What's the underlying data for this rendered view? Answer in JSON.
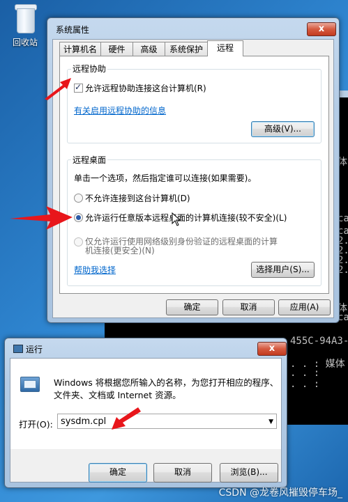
{
  "desktop": {
    "recycle_bin_label": "回收站"
  },
  "console": {
    "lines": [
      "体",
      "ca",
      "ca",
      "2.",
      "2.",
      "2.",
      "2.",
      "体",
      "ca",
      "455C-94A3-",
      ". . : 媒体",
      ". . :",
      ". . :"
    ]
  },
  "system_properties": {
    "title": "系统属性",
    "close_label": "x",
    "tabs": [
      "计算机名",
      "硬件",
      "高级",
      "系统保护",
      "远程"
    ],
    "active_tab": "远程",
    "remote_assistance": {
      "group_title": "远程协助",
      "checkbox_label": "允许远程协助连接这台计算机(R)",
      "checked": true,
      "info_link": "有关启用远程协助的信息",
      "advanced_button": "高级(V)..."
    },
    "remote_desktop": {
      "group_title": "远程桌面",
      "instruction": "单击一个选项，然后指定谁可以连接(如果需要)。",
      "option1": "不允许连接到这台计算机(D)",
      "option2": "允许运行任意版本远程桌面的计算机连接(较不安全)(L)",
      "option3_line1": "仅允许运行使用网络级别身份验证的远程桌面的计算",
      "option3_line2": "机连接(更安全)(N)",
      "selected": "option2",
      "help_link": "帮助我选择",
      "select_users_button": "选择用户(S)..."
    },
    "ok_button": "确定",
    "cancel_button": "取消",
    "apply_button": "应用(A)"
  },
  "run_dialog": {
    "title": "运行",
    "close_label": "x",
    "description_line1": "Windows 将根据您所输入的名称，为您打开相应的程序、",
    "description_line2": "文件夹、文档或 Internet 资源。",
    "open_label": "打开(O):",
    "open_value": "sysdm.cpl",
    "ok_button": "确定",
    "cancel_button": "取消",
    "browse_button": "浏览(B)..."
  },
  "watermark": "CSDN @龙卷风摧毁停车场_",
  "colors": {
    "annotation_arrow": "#e8161b",
    "link": "#0066cc"
  }
}
